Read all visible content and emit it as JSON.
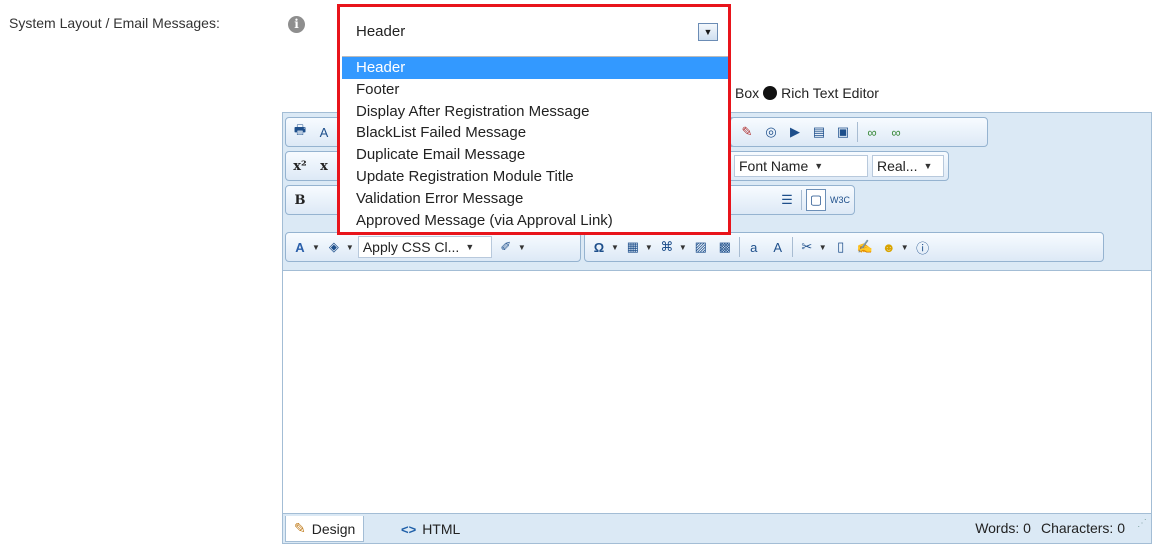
{
  "field": {
    "label": "System Layout / Email Messages:",
    "info_icon": "info-icon"
  },
  "dropdown": {
    "selected": "Header",
    "options": [
      "Header",
      "Footer",
      "Display After Registration Message",
      "BlackList Failed Message",
      "Duplicate Email Message",
      "Update Registration Module Title",
      "Validation Error Message",
      "Approved Message (via Approval Link)"
    ],
    "highlight_color": "#e8141b",
    "selected_color": "#3399ff"
  },
  "editor_mode": {
    "partial_label": "Box",
    "rich_text_label": "Rich Text Editor"
  },
  "toolbar": {
    "font_name": "Font Name",
    "font_size": "Real...",
    "apply_css": "Apply CSS Cl...",
    "bold": "B",
    "font_color": "A",
    "omega": "Ω",
    "w3c": "W3C"
  },
  "status_bar": {
    "design_tab": "Design",
    "html_tab": "HTML",
    "words": "Words: 0",
    "characters": "Characters: 0"
  }
}
